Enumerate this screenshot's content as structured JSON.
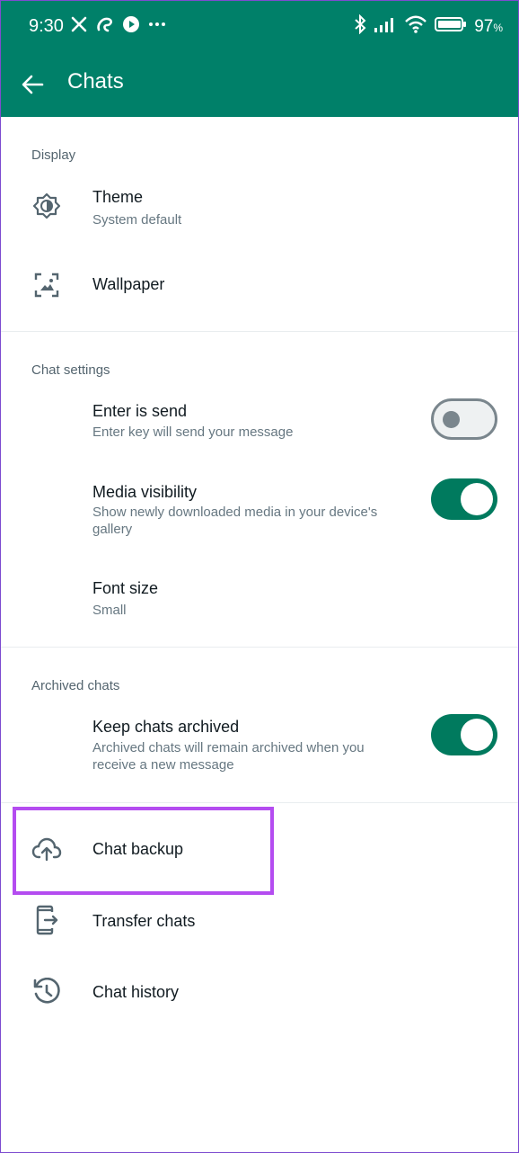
{
  "status_bar": {
    "time": "9:30",
    "left_icons": [
      "x-icon",
      "airtel-icon",
      "play-icon",
      "more-dots-icon"
    ],
    "battery_value": "97",
    "battery_unit": "%"
  },
  "app_bar": {
    "title": "Chats"
  },
  "display": {
    "header": "Display",
    "theme": {
      "title": "Theme",
      "subtitle": "System default"
    },
    "wallpaper": {
      "title": "Wallpaper"
    }
  },
  "chat_settings": {
    "header": "Chat settings",
    "enter_is_send": {
      "title": "Enter is send",
      "subtitle": "Enter key will send your message",
      "enabled": false
    },
    "media_visibility": {
      "title": "Media visibility",
      "subtitle": "Show newly downloaded media in your device's gallery",
      "enabled": true
    },
    "font_size": {
      "title": "Font size",
      "subtitle": "Small"
    }
  },
  "archived_chats": {
    "header": "Archived chats",
    "keep_archived": {
      "title": "Keep chats archived",
      "subtitle": "Archived chats will remain archived when you receive a new message",
      "enabled": true
    }
  },
  "more": {
    "chat_backup": {
      "title": "Chat backup"
    },
    "transfer_chats": {
      "title": "Transfer chats"
    },
    "chat_history": {
      "title": "Chat history"
    }
  },
  "colors": {
    "brand": "#008069",
    "toggle_on": "#007a5e",
    "highlight": "#b44cf0"
  }
}
